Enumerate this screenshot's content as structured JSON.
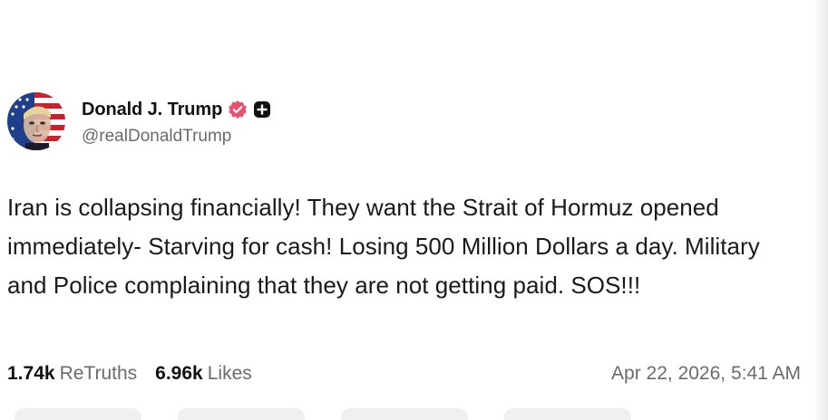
{
  "post": {
    "display_name": "Donald J. Trump",
    "handle": "@realDonaldTrump",
    "text": "Iran is collapsing financially! They want the Strait of Hormuz opened immediately- Starving for cash! Losing 500 Million Dollars a day. Military and Police complaining that they are not getting paid. SOS!!!",
    "retruths_count": "1.74k",
    "retruths_label": "ReTruths",
    "likes_count": "6.96k",
    "likes_label": "Likes",
    "timestamp": "Apr 22, 2026, 5:41 AM"
  },
  "icons": {
    "verified": "verified-badge-icon",
    "plus": "plus-badge-icon"
  },
  "colors": {
    "verified_badge": "#e8506d",
    "handle_text": "#6b6b6b",
    "primary_text": "#111111"
  }
}
